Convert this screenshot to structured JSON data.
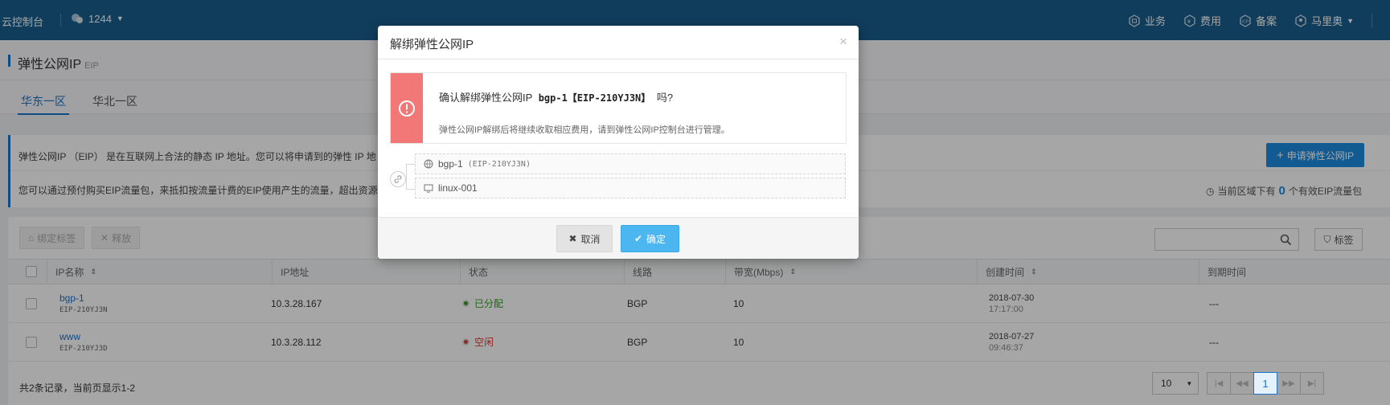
{
  "topbar": {
    "brand": "云控制台",
    "project": "1244",
    "nav": {
      "business": "业务",
      "fees": "费用",
      "icp": "备案",
      "user": "马里奥"
    }
  },
  "page": {
    "title": "弹性公网IP",
    "subtitle": "EIP"
  },
  "regions": [
    "华东一区",
    "华北一区"
  ],
  "info": {
    "line1": "弹性公网IP （EIP） 是在互联网上合法的静态 IP 地址。您可以将申请到的弹性 IP 地",
    "line2": "您可以通过预付购买EIP流量包，来抵扣按流量计费的EIP使用产生的流量，超出资源",
    "apply_button": "申请弹性公网IP",
    "eip_count_prefix": "当前区域下有",
    "eip_count": "0",
    "eip_count_suffix": "个有效EIP流量包"
  },
  "toolbar": {
    "bind_tag": "绑定标签",
    "release": "释放",
    "tag": "标签"
  },
  "table": {
    "headers": [
      "IP名称",
      "IP地址",
      "状态",
      "线路",
      "带宽(Mbps)",
      "创建时间",
      "到期时间"
    ],
    "rows": [
      {
        "name": "bgp-1",
        "id": "EIP-210YJ3N",
        "ip": "10.3.28.167",
        "status": "已分配",
        "line": "BGP",
        "bandwidth": "10",
        "date": "2018-07-30",
        "time": "17:17:00",
        "expire": "---"
      },
      {
        "name": "www",
        "id": "EIP-210YJ3D",
        "ip": "10.3.28.112",
        "status": "空闲",
        "line": "BGP",
        "bandwidth": "10",
        "date": "2018-07-27",
        "time": "09:46:37",
        "expire": "---"
      }
    ],
    "footer": "共2条记录，当前页显示1-2",
    "page_size": "10",
    "current_page": "1"
  },
  "modal": {
    "title": "解绑弹性公网IP",
    "question_prefix": "确认解绑弹性公网IP",
    "question_target": "bgp-1【EIP-210YJ3N】",
    "question_suffix": "吗?",
    "note": "弹性公网IP解绑后将继续收取相应费用，请到弹性公网IP控制台进行管理。",
    "eip_name": "bgp-1",
    "eip_id": "(EIP-210YJ3N)",
    "host": "linux-001",
    "cancel": "取消",
    "confirm": "确定"
  },
  "colors": {
    "topbar": "#1a5f8e",
    "accent": "#1a73c9",
    "warn": "#f27878",
    "confirm": "#4cb6f0"
  }
}
